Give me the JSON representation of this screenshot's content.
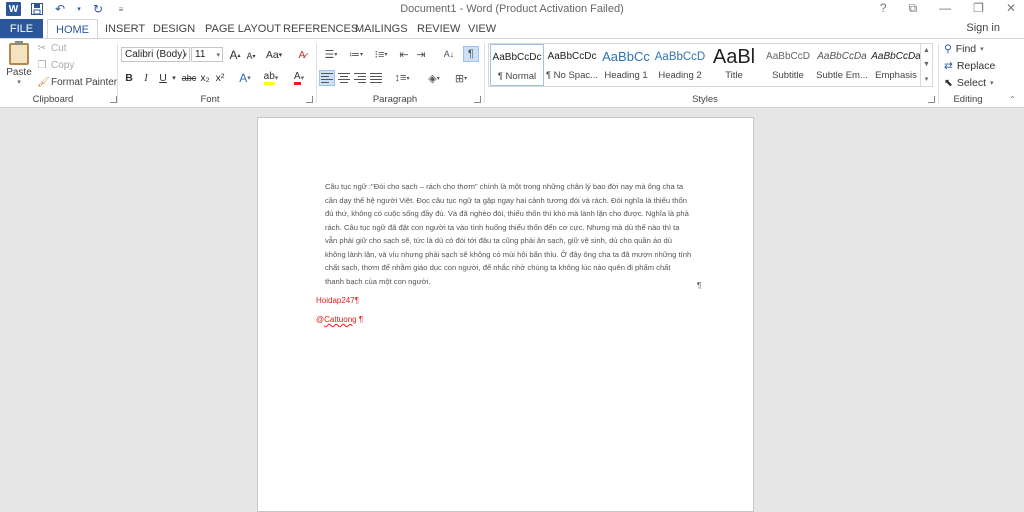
{
  "window": {
    "title": "Document1 - Word (Product Activation Failed)",
    "help": "?",
    "ribbon_options": "⧉",
    "minimize": "—",
    "restore": "❐",
    "close": "✕"
  },
  "quick_access": {
    "logo": "W",
    "save_icon": "save-icon",
    "undo_icon": "undo-icon",
    "redo_icon": "redo-icon",
    "customize_icon": "customize-icon"
  },
  "tabs": {
    "file": "FILE",
    "items": [
      "HOME",
      "INSERT",
      "DESIGN",
      "PAGE LAYOUT",
      "REFERENCES",
      "MAILINGS",
      "REVIEW",
      "VIEW"
    ],
    "active": "HOME",
    "sign_in": "Sign in"
  },
  "clipboard": {
    "paste": "Paste",
    "cut": "Cut",
    "copy": "Copy",
    "format_painter": "Format Painter",
    "label": "Clipboard"
  },
  "font": {
    "family": "Calibri (Body)",
    "size": "11",
    "grow": "A",
    "shrink": "A",
    "case": "Aa",
    "bold": "B",
    "italic": "I",
    "underline": "U",
    "strikethrough": "abc",
    "subscript": "x₂",
    "superscript": "x²",
    "effects": "A",
    "highlight": "ab",
    "color": "A",
    "label": "Font"
  },
  "paragraph": {
    "label": "Paragraph",
    "pilcrow": "¶",
    "sort": "A↓"
  },
  "styles": {
    "label": "Styles",
    "items": [
      {
        "sample": "AaBbCcDc",
        "name": "¶ Normal"
      },
      {
        "sample": "AaBbCcDc",
        "name": "¶ No Spac..."
      },
      {
        "sample": "AaBbCc",
        "name": "Heading 1"
      },
      {
        "sample": "AaBbCcD",
        "name": "Heading 2"
      },
      {
        "sample": "AaBl",
        "name": "Title"
      },
      {
        "sample": "AaBbCcD",
        "name": "Subtitle"
      },
      {
        "sample": "AaBbCcDa",
        "name": "Subtle Em..."
      },
      {
        "sample": "AaBbCcDa",
        "name": "Emphasis"
      }
    ]
  },
  "editing": {
    "find": "Find",
    "replace": "Replace",
    "select": "Select",
    "label": "Editing"
  },
  "document": {
    "body_lines": [
      "Câu tục ngữ :\"Đói cho sạch – rách cho thơm\" chính là một trong những chân lý bao đời nay mà ông cha ta",
      "cần dạy thế hệ người Việt. Đọc câu tục ngữ ta gặp ngay hai cảnh tương đói và rách. Đói nghĩa là thiếu thốn",
      "đủ thứ, không có cuộc sống đầy đủ. Và đã nghèo đói, thiếu thốn thì khó mà lành lặn cho được. Nghĩa là phả",
      "rách. Câu tục ngữ đã đặt con người ta vào tình huống thiếu thốn đến cơ cực. Nhưng mà dù thế nào thì ta",
      "vẫn phải giữ cho sạch sẽ, tức là dù có đói tới đâu ta cũng phải ăn sạch, giữ vệ sinh, dù cho quần áo dù",
      "không lành lặn, và víu nhưng phải sạch sẽ không có mùi hôi bẩn thỉu. Ở đây ông cha ta đã mượn những tính",
      "chất sạch, thơm để nhằm giáo dục con người, để nhắc nhở chúng ta không lúc nào quên đi phẩm chất",
      "thanh bạch của một con người."
    ],
    "pilcrow": "¶",
    "red_line_1": "Hoidap247¶",
    "red_line_2_prefix": "@",
    "red_line_2_word": "Cattuong",
    "red_line_2_suffix": " ¶"
  }
}
